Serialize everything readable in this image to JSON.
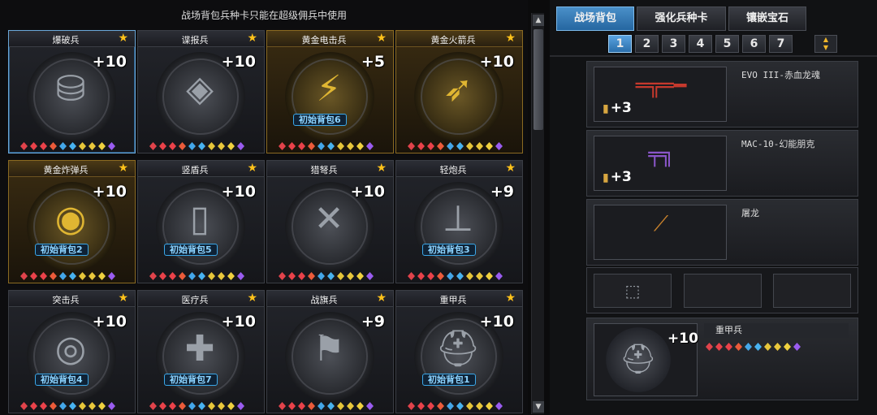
{
  "notice": "战场背包兵种卡只能在超级佣兵中使用",
  "cards": [
    {
      "title": "爆破兵",
      "plus": "+10",
      "badge": "",
      "gold": false,
      "selected": true,
      "icon": "demolition-kit-icon",
      "glyph": "⛁"
    },
    {
      "title": "谍报兵",
      "plus": "+10",
      "badge": "",
      "gold": false,
      "selected": false,
      "icon": "spy-mask-icon",
      "glyph": "◈"
    },
    {
      "title": "黄金电击兵",
      "plus": "+5",
      "badge": "初始背包6",
      "gold": true,
      "selected": false,
      "icon": "gold-shock-glove-icon",
      "glyph": "⚡"
    },
    {
      "title": "黄金火箭兵",
      "plus": "+10",
      "badge": "",
      "gold": true,
      "selected": false,
      "icon": "gold-rocket-launcher-icon",
      "glyph": "➶"
    },
    {
      "title": "黄金炸弹兵",
      "plus": "+10",
      "badge": "初始背包2",
      "gold": true,
      "selected": false,
      "icon": "gold-bomb-icon",
      "glyph": "◉"
    },
    {
      "title": "竖盾兵",
      "plus": "+10",
      "badge": "初始背包5",
      "gold": false,
      "selected": false,
      "icon": "riot-shield-icon",
      "glyph": "▯"
    },
    {
      "title": "猎弩兵",
      "plus": "+10",
      "badge": "",
      "gold": false,
      "selected": false,
      "icon": "crossbow-icon",
      "glyph": "✕"
    },
    {
      "title": "轻炮兵",
      "plus": "+9",
      "badge": "初始背包3",
      "gold": false,
      "selected": false,
      "icon": "mortar-icon",
      "glyph": "⊥"
    },
    {
      "title": "突击兵",
      "plus": "+10",
      "badge": "初始背包4",
      "gold": false,
      "selected": false,
      "icon": "assault-mine-icon",
      "glyph": "◎"
    },
    {
      "title": "医疗兵",
      "plus": "+10",
      "badge": "初始背包7",
      "gold": false,
      "selected": false,
      "icon": "medic-kit-icon",
      "glyph": "✚"
    },
    {
      "title": "战旗兵",
      "plus": "+9",
      "badge": "",
      "gold": false,
      "selected": false,
      "icon": "war-flag-icon",
      "glyph": "⚑"
    },
    {
      "title": "重甲兵",
      "plus": "+10",
      "badge": "初始背包1",
      "gold": false,
      "selected": false,
      "icon": "heavy-helmet-icon",
      "glyph": "⛑"
    }
  ],
  "gem_colors": [
    "#e0434b",
    "#e9424a",
    "#e9424a",
    "#eb5b3a",
    "#44a6e8",
    "#48b2f0",
    "#e6c53a",
    "#e9c73c",
    "#f0d13f",
    "#9a5cf0"
  ],
  "tabs": [
    {
      "label": "战场背包",
      "active": true
    },
    {
      "label": "强化兵种卡",
      "active": false
    },
    {
      "label": "镶嵌宝石",
      "active": false
    }
  ],
  "pages": [
    "1",
    "2",
    "3",
    "4",
    "5",
    "6",
    "7"
  ],
  "active_page": "1",
  "slots": [
    {
      "name": "EVO III-赤血龙魂",
      "plus": "+3",
      "icon": "assault-rifle-icon",
      "glyph": "═╦═━",
      "color": "#c6392d"
    },
    {
      "name": "MAC-10-幻能朋克",
      "plus": "+3",
      "icon": "smg-icon",
      "glyph": "╤╗",
      "color": "#8a56c9"
    },
    {
      "name": "屠龙",
      "plus": "",
      "icon": "knife-icon",
      "glyph": "⟋",
      "color": "#c9822c"
    }
  ],
  "grenade_slot": {
    "icon": "grenade-icon",
    "glyph": "⬚"
  },
  "character_slot": {
    "name": "重甲兵",
    "plus": "+10",
    "icon": "heavy-helmet-icon",
    "glyph": "⛑"
  }
}
